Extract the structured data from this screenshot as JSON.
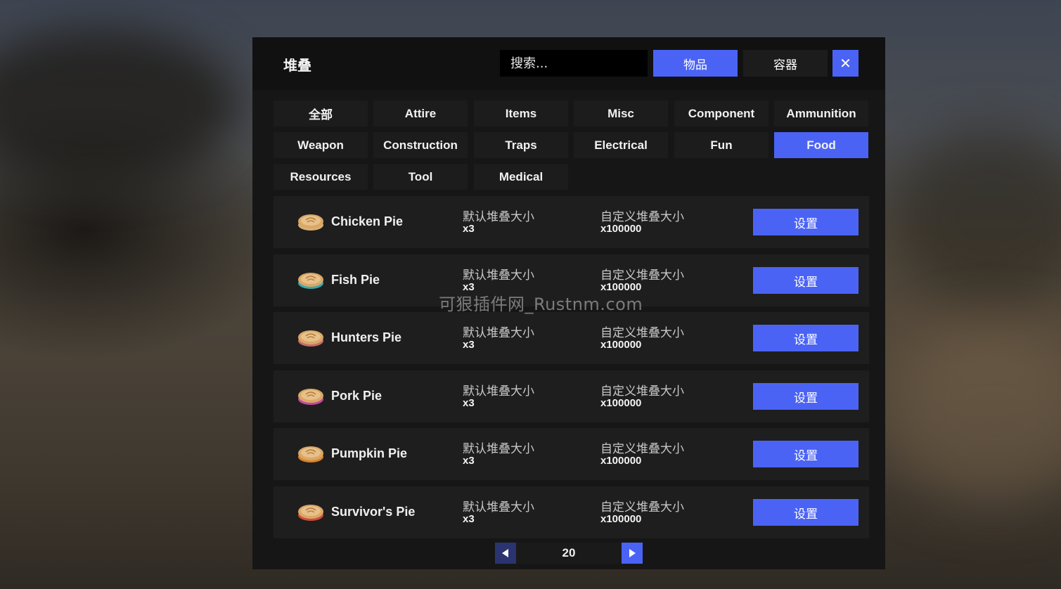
{
  "header": {
    "title": "堆叠",
    "search_placeholder": "搜索...",
    "mode_items": "物品",
    "mode_containers": "容器",
    "close": "✕"
  },
  "categories": [
    {
      "label": "全部",
      "active": false
    },
    {
      "label": "Attire",
      "active": false
    },
    {
      "label": "Items",
      "active": false
    },
    {
      "label": "Misc",
      "active": false
    },
    {
      "label": "Component",
      "active": false
    },
    {
      "label": "Ammunition",
      "active": false
    },
    {
      "label": "Weapon",
      "active": false
    },
    {
      "label": "Construction",
      "active": false
    },
    {
      "label": "Traps",
      "active": false
    },
    {
      "label": "Electrical",
      "active": false
    },
    {
      "label": "Fun",
      "active": false
    },
    {
      "label": "Food",
      "active": true
    },
    {
      "label": "Resources",
      "active": false
    },
    {
      "label": "Tool",
      "active": false
    },
    {
      "label": "Medical",
      "active": false
    }
  ],
  "rows": [
    {
      "name": "Chicken Pie",
      "default_label": "默认堆叠大小",
      "default_value": "x3",
      "custom_label": "自定义堆叠大小",
      "custom_value": "x100000",
      "button": "设置",
      "icon": "pie-icon",
      "filling_color": "#d7b070"
    },
    {
      "name": "Fish Pie",
      "default_label": "默认堆叠大小",
      "default_value": "x3",
      "custom_label": "自定义堆叠大小",
      "custom_value": "x100000",
      "button": "设置",
      "icon": "pie-icon",
      "filling_color": "#3aa6b0"
    },
    {
      "name": "Hunters Pie",
      "default_label": "默认堆叠大小",
      "default_value": "x3",
      "custom_label": "自定义堆叠大小",
      "custom_value": "x100000",
      "button": "设置",
      "icon": "pie-icon",
      "filling_color": "#c76a6a"
    },
    {
      "name": "Pork Pie",
      "default_label": "默认堆叠大小",
      "default_value": "x3",
      "custom_label": "自定义堆叠大小",
      "custom_value": "x100000",
      "button": "设置",
      "icon": "pie-icon",
      "filling_color": "#c24aa0"
    },
    {
      "name": "Pumpkin Pie",
      "default_label": "默认堆叠大小",
      "default_value": "x3",
      "custom_label": "自定义堆叠大小",
      "custom_value": "x100000",
      "button": "设置",
      "icon": "pie-icon",
      "filling_color": "#d9822b"
    },
    {
      "name": "Survivor's Pie",
      "default_label": "默认堆叠大小",
      "default_value": "x3",
      "custom_label": "自定义堆叠大小",
      "custom_value": "x100000",
      "button": "设置",
      "icon": "pie-icon",
      "filling_color": "#d24b3a"
    }
  ],
  "pager": {
    "page": "20",
    "prev_icon": "triangle-left-icon",
    "next_icon": "triangle-right-icon"
  },
  "watermark": "可狠插件网_Rustnm.com",
  "colors": {
    "accent": "#4b63f5",
    "panel": "#161616",
    "row": "#1e1e1e"
  }
}
